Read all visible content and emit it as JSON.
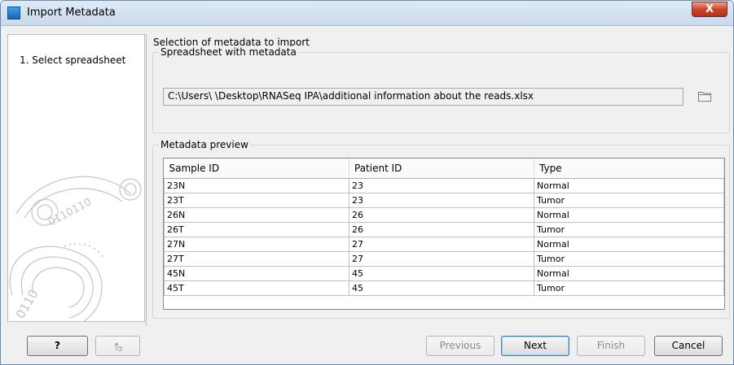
{
  "window": {
    "title": "Import Metadata",
    "close_label": "X"
  },
  "sidebar": {
    "steps": [
      {
        "label": "1.  Select spreadsheet"
      }
    ]
  },
  "main": {
    "section_title": "Selection of metadata to import",
    "spreadsheet_group": {
      "label": "Spreadsheet with metadata",
      "path_value": "C:\\Users\\              \\Desktop\\RNASeq IPA\\additional information about the reads.xlsx"
    },
    "preview_group": {
      "label": "Metadata preview",
      "columns": [
        "Sample ID",
        "Patient ID",
        "Type"
      ],
      "rows": [
        [
          "23N",
          "23",
          "Normal"
        ],
        [
          "23T",
          "23",
          "Tumor"
        ],
        [
          "26N",
          "26",
          "Normal"
        ],
        [
          "26T",
          "26",
          "Tumor"
        ],
        [
          "27N",
          "27",
          "Normal"
        ],
        [
          "27T",
          "27",
          "Tumor"
        ],
        [
          "45N",
          "45",
          "Normal"
        ],
        [
          "45T",
          "45",
          "Tumor"
        ]
      ]
    }
  },
  "footer": {
    "help_label": "?",
    "previous_label": "Previous",
    "next_label": "Next",
    "finish_label": "Finish",
    "cancel_label": "Cancel"
  },
  "colors": {
    "titlebar": "#c9d9ec",
    "close_button": "#c9462c",
    "app_icon": "#1566b8"
  },
  "icons": {
    "app": "app-icon",
    "folder": "folder-icon",
    "restore": "restore-icon"
  }
}
